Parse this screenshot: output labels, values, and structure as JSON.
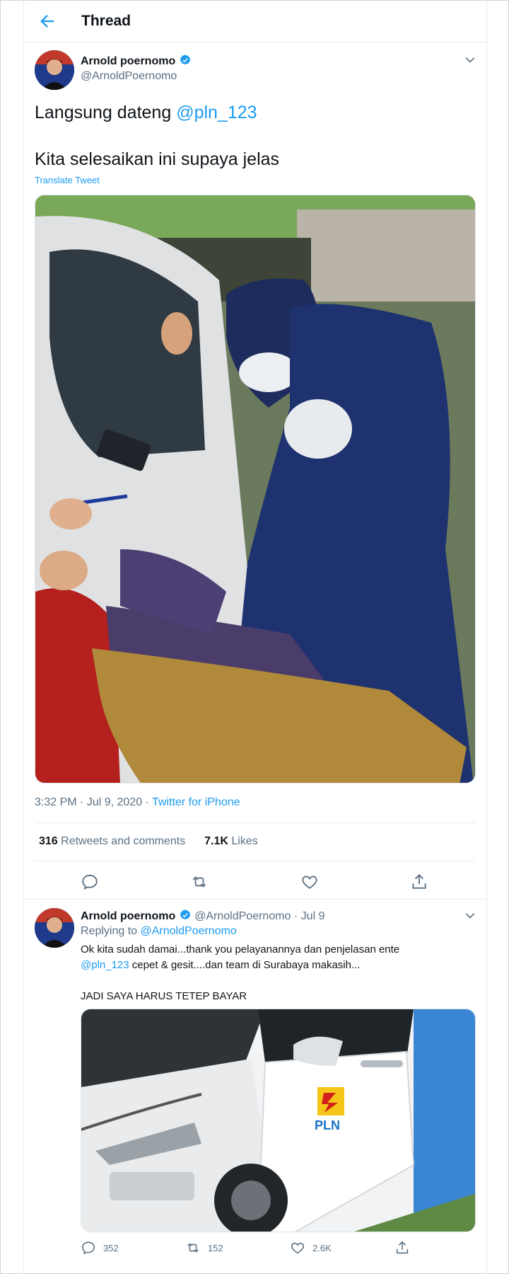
{
  "header": {
    "title": "Thread"
  },
  "main_tweet": {
    "author_name": "Arnold poernomo",
    "author_handle": "@ArnoldPoernomo",
    "text_prefix": "Langsung dateng ",
    "mention": "@pln_123",
    "text_line2": "Kita selesaikan ini supaya jelas",
    "translate_label": "Translate Tweet",
    "timestamp": "3:32 PM · Jul 9, 2020 · ",
    "source": "Twitter for iPhone",
    "retweets_count": "316",
    "retweets_label": "Retweets and comments",
    "likes_count": "7.1K",
    "likes_label": "Likes"
  },
  "reply": {
    "author_name": "Arnold poernomo",
    "author_handle": "@ArnoldPoernomo",
    "date": "· Jul 9",
    "replying_to_label": "Replying to ",
    "replying_to_handle": "@ArnoldPoernomo",
    "text_part1": "Ok kita sudah damai...thank you pelayanannya dan penjelasan ente",
    "mention": "@pln_123",
    "text_part2": " cepet & gesit....dan team di Surabaya makasih...",
    "text_line3": "JADI SAYA HARUS TETEP BAYAR",
    "logo_text": "PLN",
    "replies": "352",
    "retweets": "152",
    "likes": "2.6K"
  },
  "colors": {
    "accent": "#1d9bf0",
    "muted": "#5b7083",
    "border": "#e6ecf0"
  }
}
